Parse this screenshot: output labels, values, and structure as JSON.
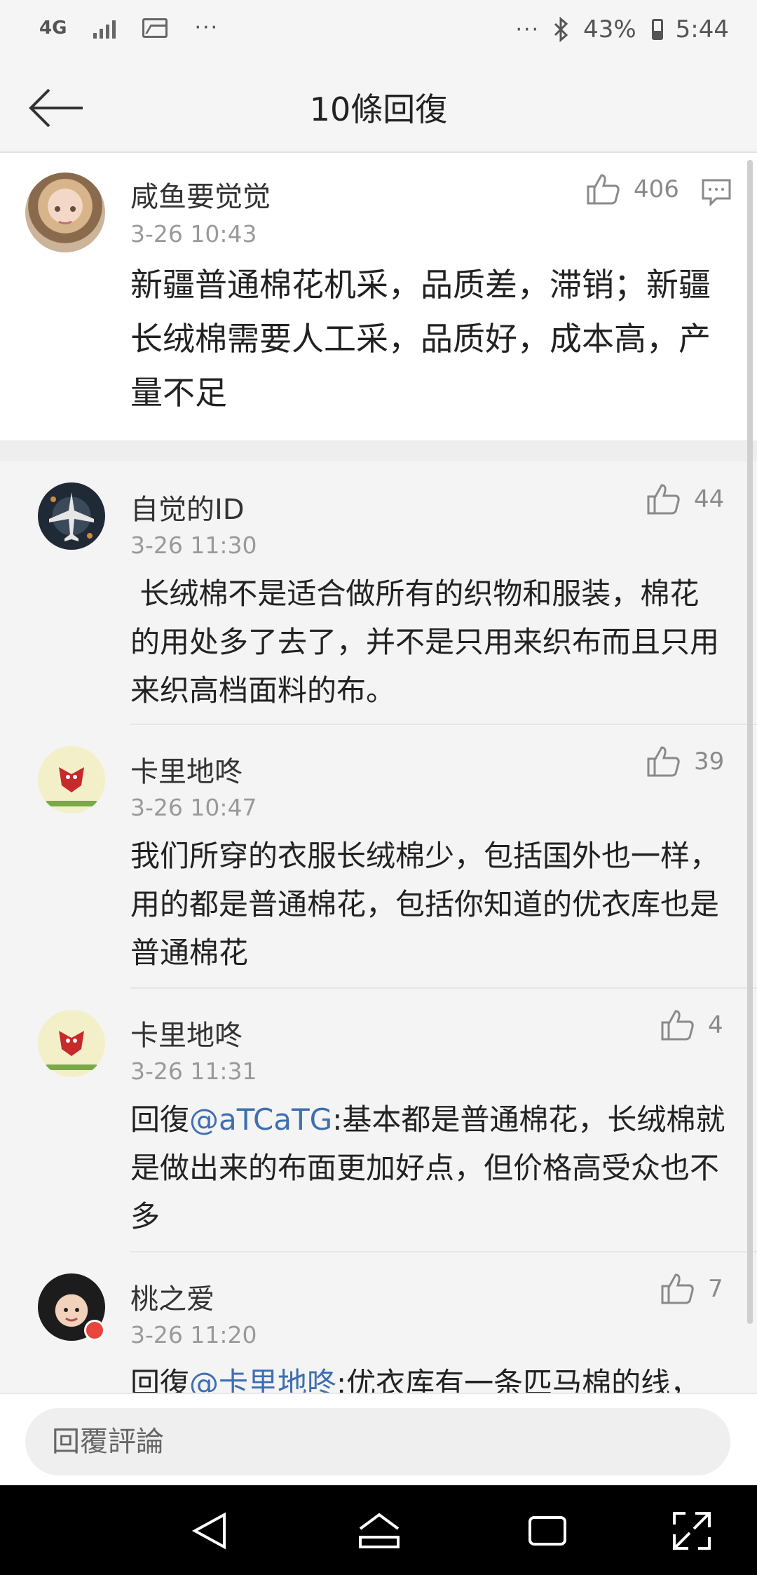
{
  "status_bar": {
    "network": "4G",
    "dots_left": "···",
    "dots_right": "···",
    "battery_percent": "43%",
    "battery_level": 0.43,
    "time": "5:44"
  },
  "header": {
    "title": "10條回復"
  },
  "main_comment": {
    "username": "咸鱼要觉觉",
    "timestamp": "3-26 10:43",
    "likes": "406",
    "text": "新疆普通棉花机采，品质差，滞销；新疆长绒棉需要人工采，品质好，成本高，产量不足"
  },
  "replies": [
    {
      "username": "自觉的ID",
      "timestamp": "3-26 11:30",
      "likes": "44",
      "text": " 长绒棉不是适合做所有的织物和服装，棉花的用处多了去了，并不是只用来织布而且只用来织高档面料的布。"
    },
    {
      "username": "卡里地咚",
      "timestamp": "3-26 10:47",
      "likes": "39",
      "text": "我们所穿的衣服长绒棉少，包括国外也一样，用的都是普通棉花，包括你知道的优衣库也是普通棉花"
    },
    {
      "username": "卡里地咚",
      "timestamp": "3-26 11:31",
      "likes": "4",
      "prefix": "回復",
      "mention": "@aTCaTG",
      "text": ":基本都是普通棉花，长绒棉就是做出来的布面更加好点，但价格高受众也不多"
    },
    {
      "username": "桃之爱",
      "timestamp": "3-26 11:20",
      "likes": "7",
      "prefix": "回復",
      "mention": "@卡里地咚",
      "text": ":优衣库有一条匹马棉的线，"
    }
  ],
  "bottom_bar": {
    "placeholder": "回覆評論"
  },
  "icons": {
    "back": "arrow-left-icon",
    "like": "thumbs-up-icon",
    "reply": "comment-icon",
    "nav_back": "triangle-back-icon",
    "nav_home": "home-icon",
    "nav_recents": "recents-icon",
    "nav_screenshot": "expand-icon"
  },
  "colors": {
    "mention": "#3e6fb0",
    "nav_bar": "#000000",
    "header_bg": "#f5f5f5"
  }
}
